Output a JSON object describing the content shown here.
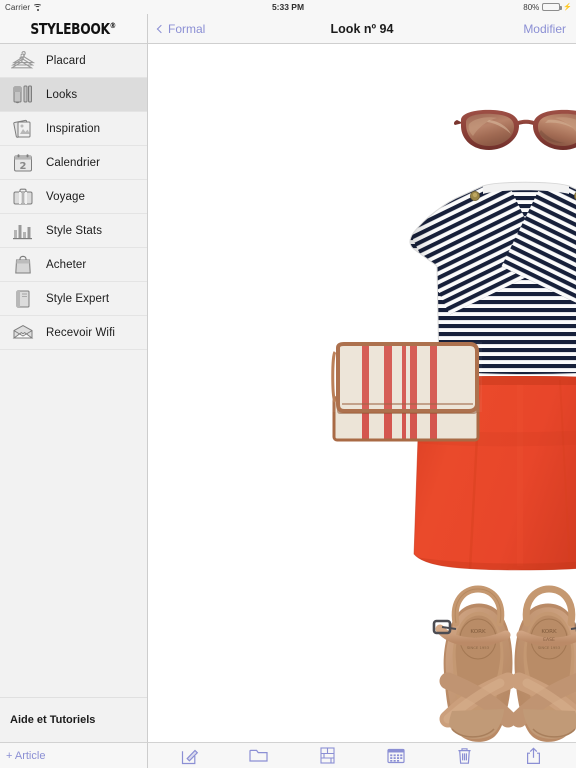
{
  "status_bar": {
    "carrier": "Carrier",
    "wifi_icon": "wifi-icon",
    "time": "5:33 PM",
    "battery_percent": "80%",
    "battery_level": 80,
    "charging_icon": "bolt-icon"
  },
  "sidebar": {
    "brand": "STYLEBOOK",
    "brand_mark": "®",
    "items": [
      {
        "label": "Placard",
        "icon": "hangers-icon",
        "selected": false
      },
      {
        "label": "Looks",
        "icon": "outfits-icon",
        "selected": true
      },
      {
        "label": "Inspiration",
        "icon": "photos-icon",
        "selected": false
      },
      {
        "label": "Calendrier",
        "icon": "calendar-icon",
        "selected": false
      },
      {
        "label": "Voyage",
        "icon": "suitcase-icon",
        "selected": false
      },
      {
        "label": "Style Stats",
        "icon": "bar-chart-icon",
        "selected": false
      },
      {
        "label": "Acheter",
        "icon": "shopping-bag-icon",
        "selected": false
      },
      {
        "label": "Style Expert",
        "icon": "book-icon",
        "selected": false
      },
      {
        "label": "Recevoir Wifi",
        "icon": "envelope-icon",
        "selected": false
      }
    ],
    "footer_label": "Aide et Tutoriels",
    "add_article_label": "+ Article"
  },
  "navbar": {
    "back_label": "Formal",
    "back_icon": "chevron-left-icon",
    "title": "Look nº 94",
    "edit_label": "Modifier"
  },
  "toolbar": {
    "buttons": [
      {
        "name": "compose-button",
        "icon": "compose-icon"
      },
      {
        "name": "folder-button",
        "icon": "folder-icon"
      },
      {
        "name": "collage-button",
        "icon": "collage-icon"
      },
      {
        "name": "calendar-button",
        "icon": "calendar-grid-icon"
      },
      {
        "name": "delete-button",
        "icon": "trash-icon"
      },
      {
        "name": "share-button",
        "icon": "share-icon"
      }
    ]
  },
  "look": {
    "items": [
      {
        "name": "sunglasses",
        "description": "Brown tortoiseshell round sunglasses",
        "colors": [
          "#8c4a42",
          "#b07a5e",
          "#c89b7d"
        ]
      },
      {
        "name": "striped-top",
        "description": "Navy and white striped boat-neck tee with gold shoulder buttons",
        "colors": [
          "#141c2e",
          "#ffffff",
          "#9a8648"
        ]
      },
      {
        "name": "striped-clutch",
        "description": "Linen clutch with red stripes and tan leather trim",
        "colors": [
          "#ece4d7",
          "#d4564f",
          "#a96a45"
        ]
      },
      {
        "name": "red-skirt",
        "description": "Red-orange A-line mini skirt",
        "colors": [
          "#e8462a",
          "#d23d22"
        ]
      },
      {
        "name": "tan-sandals",
        "description": "Tan leather cross-strap platform sandals",
        "colors": [
          "#c79a78",
          "#b78764",
          "#e0c0a2"
        ]
      }
    ]
  },
  "colors": {
    "accent": "#8b8fd4",
    "sidebar_bg": "#f2f2f2",
    "selected_row": "#dcdcdc",
    "bar_bg": "#f7f7f7",
    "battery_green": "#4cd964",
    "skirt_red": "#e8462a",
    "stripe_navy": "#141c2e"
  }
}
